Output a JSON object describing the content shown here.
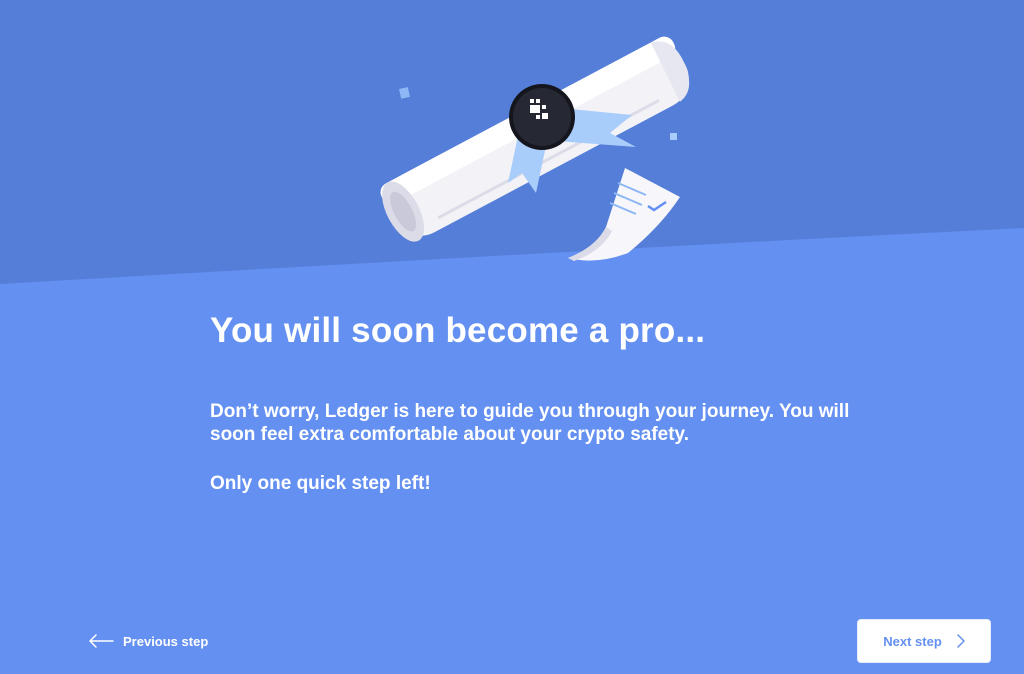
{
  "theme": {
    "background": "#6490f1",
    "top_band": "#547ed8",
    "accent": "#6490f1",
    "text": "#ffffff"
  },
  "illustration": {
    "name": "diploma-scroll-with-ledger-seal",
    "icons": [
      "scroll-icon",
      "ledger-seal-icon",
      "document-check-icon"
    ]
  },
  "main": {
    "title": "You will soon become a pro...",
    "paragraph": "Don’t worry, Ledger is here to guide you through your journey. You will soon feel extra comfortable about your crypto safety.",
    "paragraph_2": "Only one quick step left!"
  },
  "footer": {
    "previous_label": "Previous step",
    "next_label": "Next step"
  }
}
